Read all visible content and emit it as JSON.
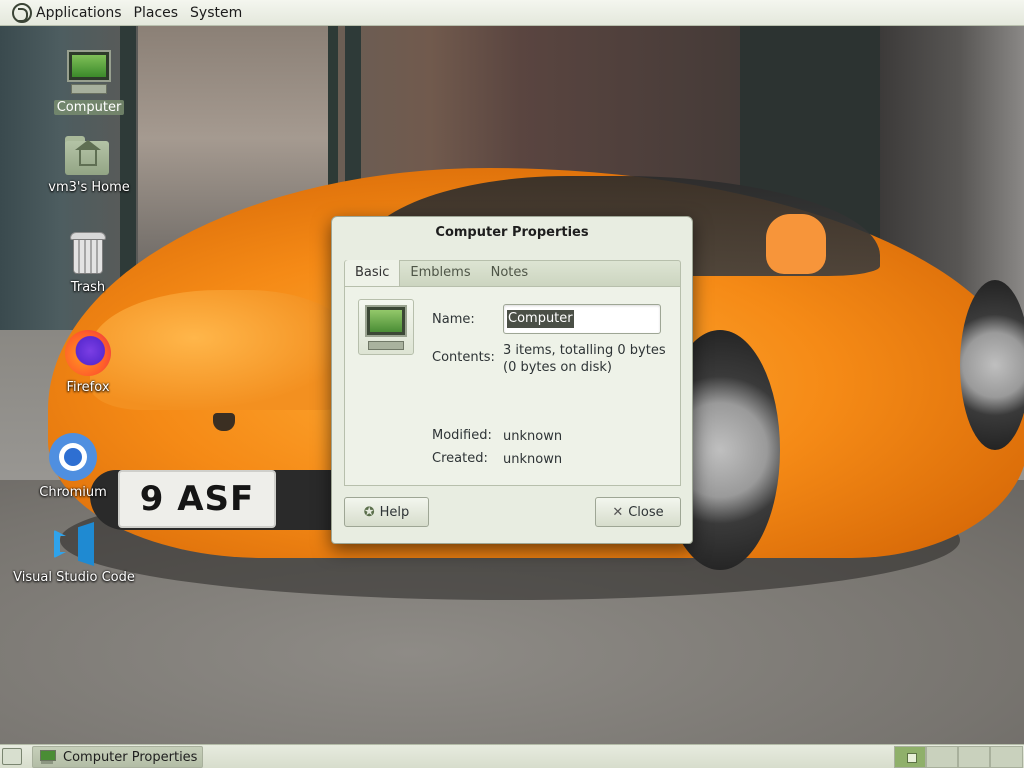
{
  "top_panel": {
    "menus": [
      "Applications",
      "Places",
      "System"
    ]
  },
  "desktop": {
    "icons": [
      {
        "label": "Computer",
        "icon": "computer-icon"
      },
      {
        "label": "vm3's Home",
        "icon": "home-folder-icon"
      },
      {
        "label": "Trash",
        "icon": "trash-icon"
      },
      {
        "label": "Firefox",
        "icon": "firefox-icon"
      },
      {
        "label": "Chromium",
        "icon": "chromium-icon"
      },
      {
        "label": "Visual Studio Code",
        "icon": "vscode-icon"
      }
    ],
    "wallpaper_plate": "9 ASF"
  },
  "dialog": {
    "title": "Computer Properties",
    "tabs": [
      "Basic",
      "Emblems",
      "Notes"
    ],
    "active_tab": "Basic",
    "name_label": "Name:",
    "name_value": "Computer",
    "contents_label": "Contents:",
    "contents_value_1": "3 items, totalling 0 bytes",
    "contents_value_2": "(0 bytes on disk)",
    "modified_label": "Modified:",
    "modified_value": "unknown",
    "created_label": "Created:",
    "created_value": "unknown",
    "help_button": "Help",
    "close_button": "Close"
  },
  "bottom_panel": {
    "task_label": "Computer Properties"
  },
  "colors": {
    "panel": "#e4e8dc",
    "dialog_bg": "#e8ede1",
    "accent": "#8fb06a"
  }
}
